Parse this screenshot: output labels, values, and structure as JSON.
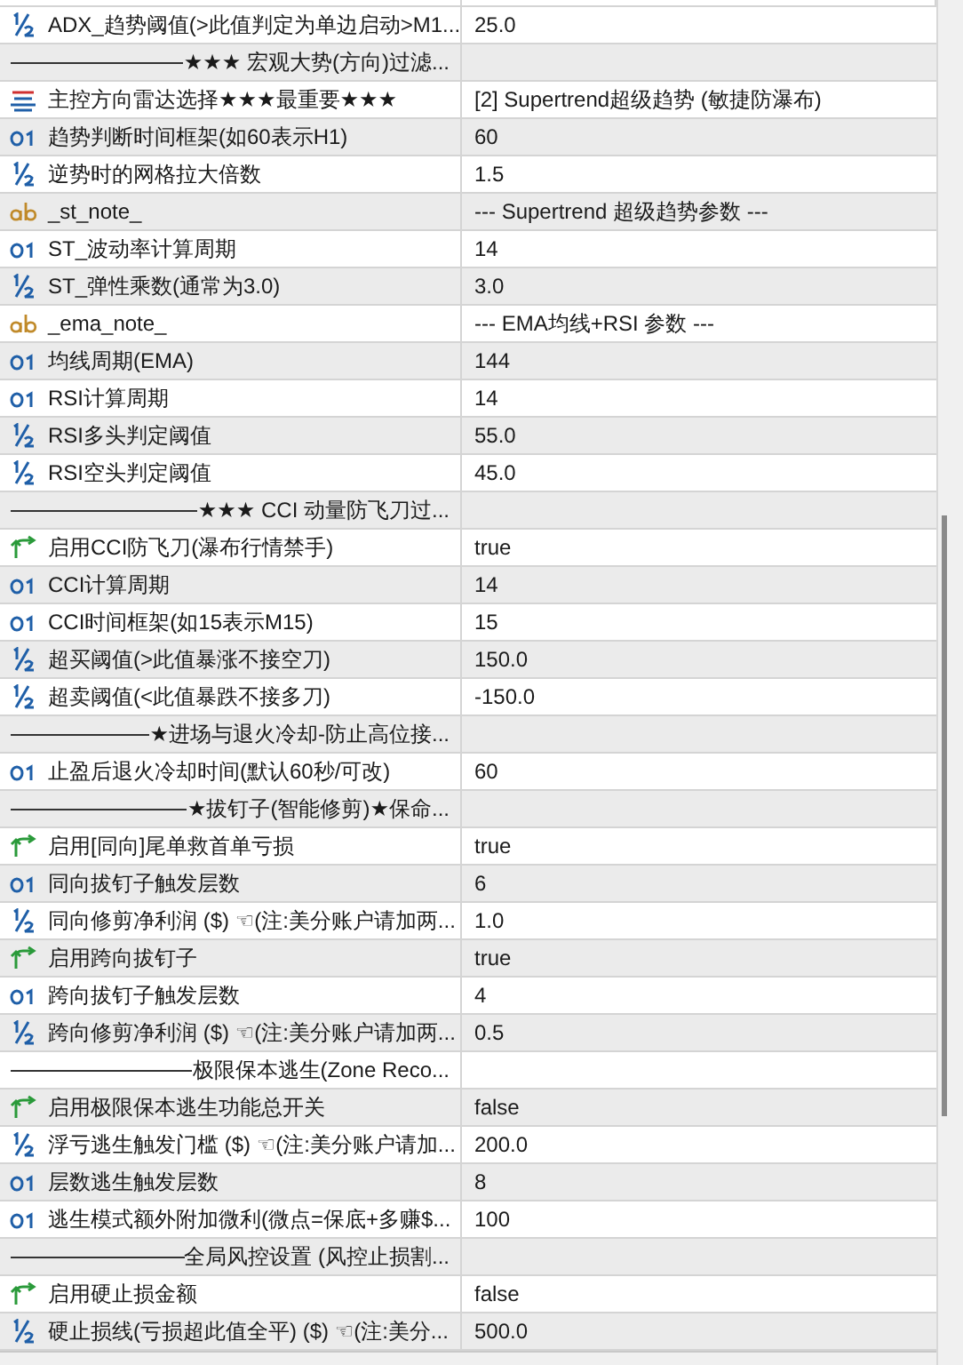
{
  "rows": [
    {
      "kind": "double",
      "name": "ADX_趋势阈值(>此值判定为单边启动>M1...",
      "value": "25.0"
    },
    {
      "kind": "separator",
      "name": "★★★ 宏观大势(方向)过滤..."
    },
    {
      "kind": "enum",
      "name": "主控方向雷达选择★★★最重要★★★",
      "value": "[2] Supertrend超级趋势 (敏捷防瀑布)"
    },
    {
      "kind": "int",
      "name": "趋势判断时间框架(如60表示H1)",
      "value": "60"
    },
    {
      "kind": "double",
      "name": "逆势时的网格拉大倍数",
      "value": "1.5"
    },
    {
      "kind": "string",
      "name": "_st_note_",
      "value": "--- Supertrend 超级趋势参数 ---"
    },
    {
      "kind": "int",
      "name": "ST_波动率计算周期",
      "value": "14"
    },
    {
      "kind": "double",
      "name": "ST_弹性乘数(通常为3.0)",
      "value": "3.0"
    },
    {
      "kind": "string",
      "name": "_ema_note_",
      "value": "--- EMA均线+RSI 参数 ---"
    },
    {
      "kind": "int",
      "name": "均线周期(EMA)",
      "value": "144"
    },
    {
      "kind": "int",
      "name": "RSI计算周期",
      "value": "14"
    },
    {
      "kind": "double",
      "name": "RSI多头判定阈值",
      "value": "55.0"
    },
    {
      "kind": "double",
      "name": "RSI空头判定阈值",
      "value": "45.0"
    },
    {
      "kind": "separator",
      "name": "★★★ CCI 动量防飞刀过..."
    },
    {
      "kind": "bool",
      "name": "启用CCI防飞刀(瀑布行情禁手)",
      "value": "true"
    },
    {
      "kind": "int",
      "name": "CCI计算周期",
      "value": "14"
    },
    {
      "kind": "int",
      "name": "CCI时间框架(如15表示M15)",
      "value": "15"
    },
    {
      "kind": "double",
      "name": "超买阈值(>此值暴涨不接空刀)",
      "value": "150.0"
    },
    {
      "kind": "double",
      "name": "超卖阈值(<此值暴跌不接多刀)",
      "value": "-150.0"
    },
    {
      "kind": "separator",
      "name": "★进场与退火冷却-防止高位接..."
    },
    {
      "kind": "int",
      "name": "止盈后退火冷却时间(默认60秒/可改)",
      "value": "60"
    },
    {
      "kind": "separator",
      "name": "★拔钉子(智能修剪)★保命..."
    },
    {
      "kind": "bool",
      "name": "启用[同向]尾单救首单亏损",
      "value": "true"
    },
    {
      "kind": "int",
      "name": "同向拔钉子触发层数",
      "value": "6"
    },
    {
      "kind": "double",
      "name": "同向修剪净利润 ($) ☜(注:美分账户请加两...",
      "value": "1.0"
    },
    {
      "kind": "bool",
      "name": "启用跨向拔钉子",
      "value": "true"
    },
    {
      "kind": "int",
      "name": "跨向拔钉子触发层数",
      "value": "4"
    },
    {
      "kind": "double",
      "name": "跨向修剪净利润 ($) ☜(注:美分账户请加两...",
      "value": "0.5"
    },
    {
      "kind": "separator",
      "name": "极限保本逃生(Zone Reco..."
    },
    {
      "kind": "bool",
      "name": "启用极限保本逃生功能总开关",
      "value": "false"
    },
    {
      "kind": "double",
      "name": "浮亏逃生触发门槛 ($) ☜(注:美分账户请加...",
      "value": "200.0"
    },
    {
      "kind": "int",
      "name": "层数逃生触发层数",
      "value": "8"
    },
    {
      "kind": "int",
      "name": "逃生模式额外附加微利(微点=保底+多赚$...",
      "value": "100"
    },
    {
      "kind": "separator",
      "name": "全局风控设置 (风控止损割..."
    },
    {
      "kind": "bool",
      "name": "启用硬止损金额",
      "value": "false"
    },
    {
      "kind": "double",
      "name": "硬止损线(亏损超此值全平) ($) ☜(注:美分...",
      "value": "500.0"
    }
  ]
}
